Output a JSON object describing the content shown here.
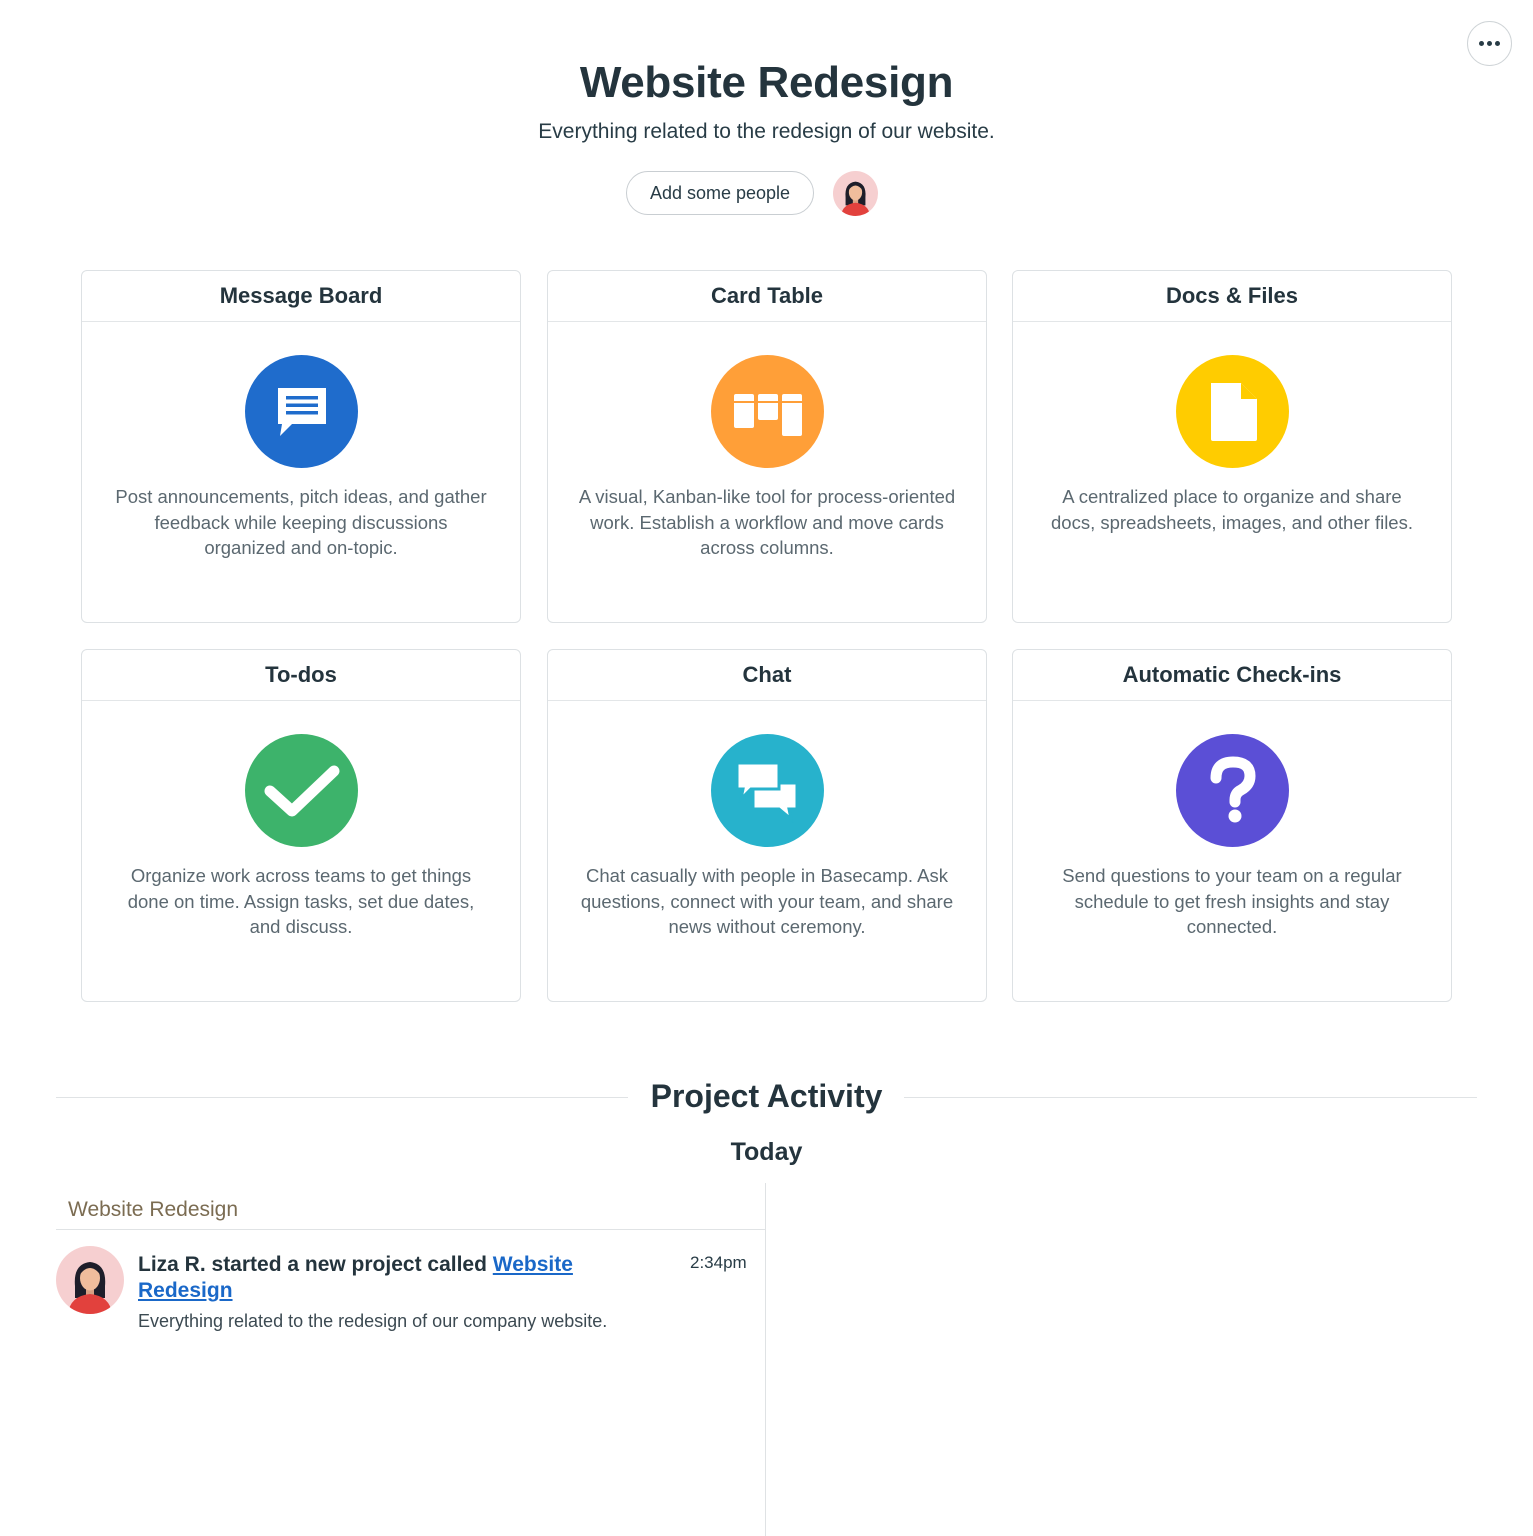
{
  "header": {
    "title": "Website Redesign",
    "subtitle": "Everything related to the redesign of our website.",
    "add_people_label": "Add some people",
    "more_icon": "ellipsis-icon"
  },
  "tools": [
    {
      "name": "Message Board",
      "icon": "message-board-icon",
      "color": "#1f6ccc",
      "description": "Post announcements, pitch ideas, and gather feedback while keeping discussions organized and on-topic."
    },
    {
      "name": "Card Table",
      "icon": "kanban-icon",
      "color": "#ff9f38",
      "description": "A visual, Kanban-like tool for process-oriented work. Establish a workflow and move cards across columns."
    },
    {
      "name": "Docs & Files",
      "icon": "document-icon",
      "color": "#ffcc00",
      "description": "A centralized place to organize and share docs, spreadsheets, images, and other files."
    },
    {
      "name": "To-dos",
      "icon": "checkmark-icon",
      "color": "#3db36b",
      "description": "Organize work across teams to get things done on time. Assign tasks, set due dates, and discuss."
    },
    {
      "name": "Chat",
      "icon": "chat-bubbles-icon",
      "color": "#27b2cc",
      "description": "Chat casually with people in Basecamp. Ask questions, connect with your team, and share news without ceremony."
    },
    {
      "name": "Automatic Check-ins",
      "icon": "question-mark-icon",
      "color": "#5b4fd6",
      "description": "Send questions to your team on a regular schedule to get fresh insights and stay connected."
    }
  ],
  "activity": {
    "section_title": "Project Activity",
    "day_label": "Today",
    "project_label": "Website Redesign",
    "items": [
      {
        "actor_text": "Liza R. started a new project called ",
        "link_text": "Website Redesign",
        "time": "2:34pm",
        "description": "Everything related to the redesign of our company website."
      }
    ]
  }
}
